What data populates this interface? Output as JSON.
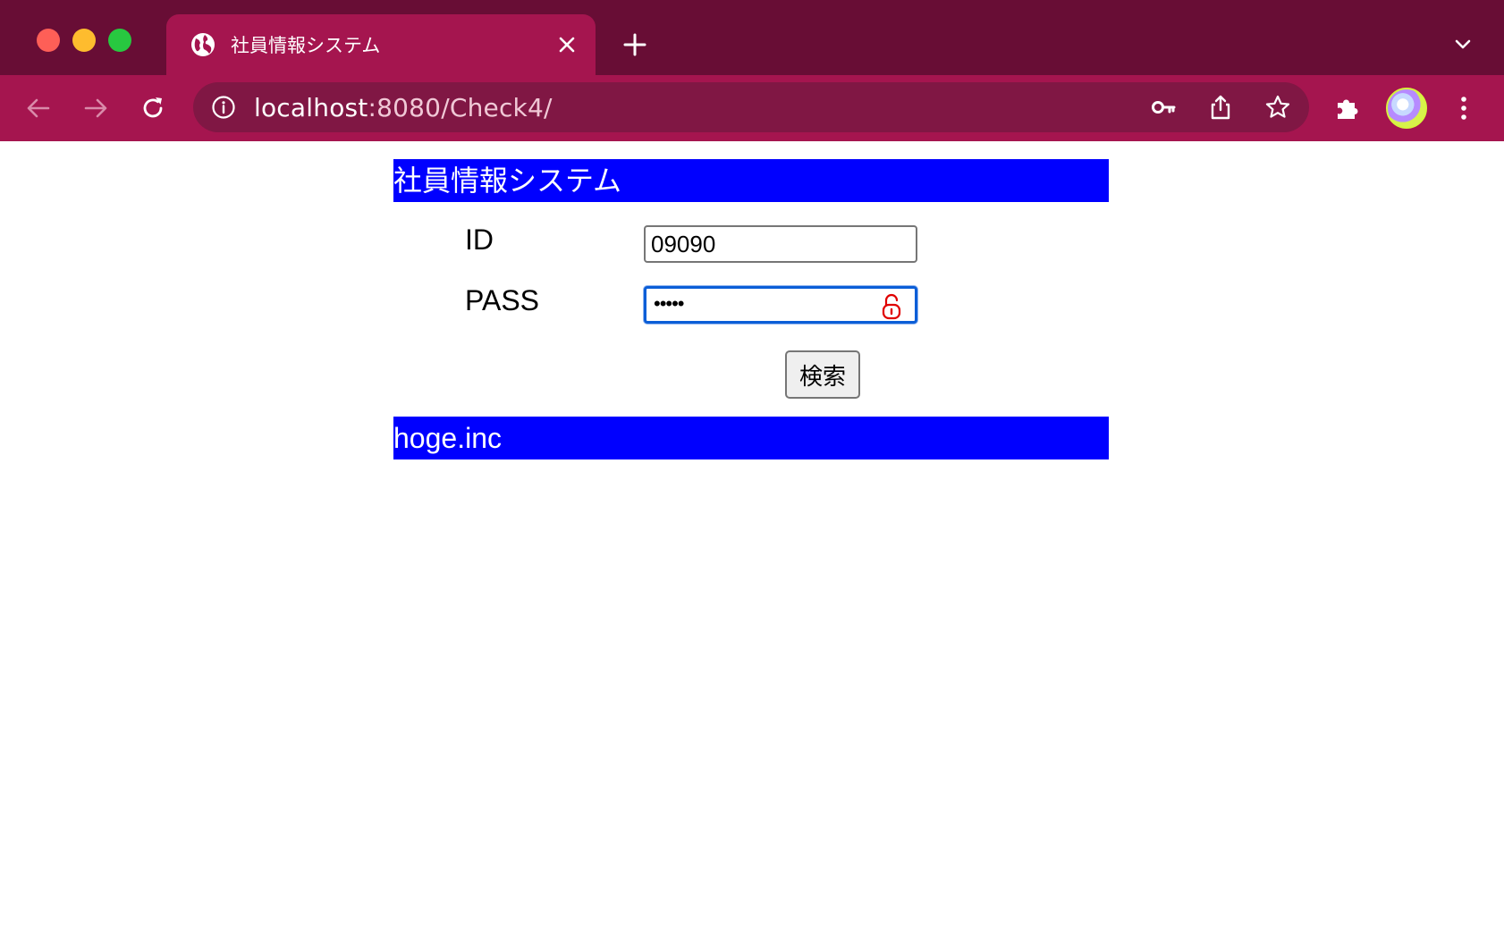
{
  "browser": {
    "tab": {
      "title": "社員情報システム"
    },
    "address_bar": {
      "host": "localhost",
      "path": ":8080/Check4/"
    }
  },
  "page": {
    "header_title": "社員情報システム",
    "form": {
      "id_label": "ID",
      "id_value": "09090",
      "pass_label": "PASS",
      "pass_masked": "•••••",
      "submit_label": "検索"
    },
    "footer_text": "hoge.inc"
  },
  "colors": {
    "chrome_dark": "#680d35",
    "chrome_tab": "#a5154f",
    "banner": "#0000ff",
    "focus_ring": "#0b5ed7",
    "lock_icon": "#e00000"
  }
}
